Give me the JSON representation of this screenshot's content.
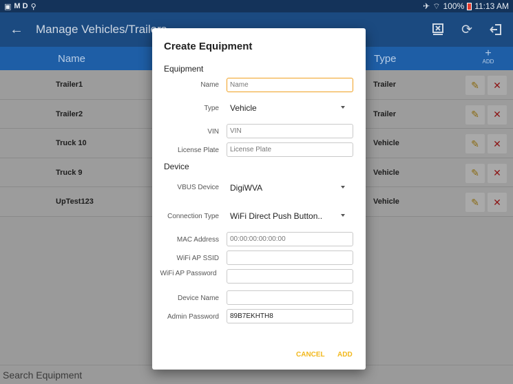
{
  "status_bar": {
    "left_text": "M D",
    "battery": "100%",
    "time": "11:13 AM"
  },
  "app_bar": {
    "title": "Manage Vehicles/Trailers"
  },
  "table": {
    "col_name": "Name",
    "col_type": "Type",
    "add_label": "ADD",
    "rows": [
      {
        "name": "Trailer1",
        "type": "Trailer"
      },
      {
        "name": "Trailer2",
        "type": "Trailer"
      },
      {
        "name": "Truck 10",
        "type": "Vehicle"
      },
      {
        "name": "Truck 9",
        "type": "Vehicle"
      },
      {
        "name": "UpTest123",
        "type": "Vehicle"
      }
    ]
  },
  "search": {
    "placeholder": "Search Equipment"
  },
  "dialog": {
    "title": "Create Equipment",
    "equipment_section": "Equipment",
    "device_section": "Device",
    "name": {
      "label": "Name",
      "placeholder": "Name",
      "value": ""
    },
    "type": {
      "label": "Type",
      "value": "Vehicle"
    },
    "vin": {
      "label": "VIN",
      "placeholder": "VIN",
      "value": ""
    },
    "license_plate": {
      "label": "License Plate",
      "placeholder": "License Plate",
      "value": ""
    },
    "vbus_device": {
      "label": "VBUS Device",
      "value": "DigiWVA"
    },
    "connection_type": {
      "label": "Connection Type",
      "value": "WiFi Direct Push Button.."
    },
    "mac_address": {
      "label": "MAC Address",
      "placeholder": "00:00:00:00:00:00",
      "value": ""
    },
    "wifi_ssid": {
      "label": "WiFi AP SSID",
      "value": ""
    },
    "wifi_password": {
      "label": "WiFi AP Password",
      "value": ""
    },
    "device_name": {
      "label": "Device Name",
      "value": ""
    },
    "admin_password": {
      "label": "Admin Password",
      "value": "89B7EKHTH8"
    },
    "cancel_label": "CANCEL",
    "add_label": "ADD"
  }
}
